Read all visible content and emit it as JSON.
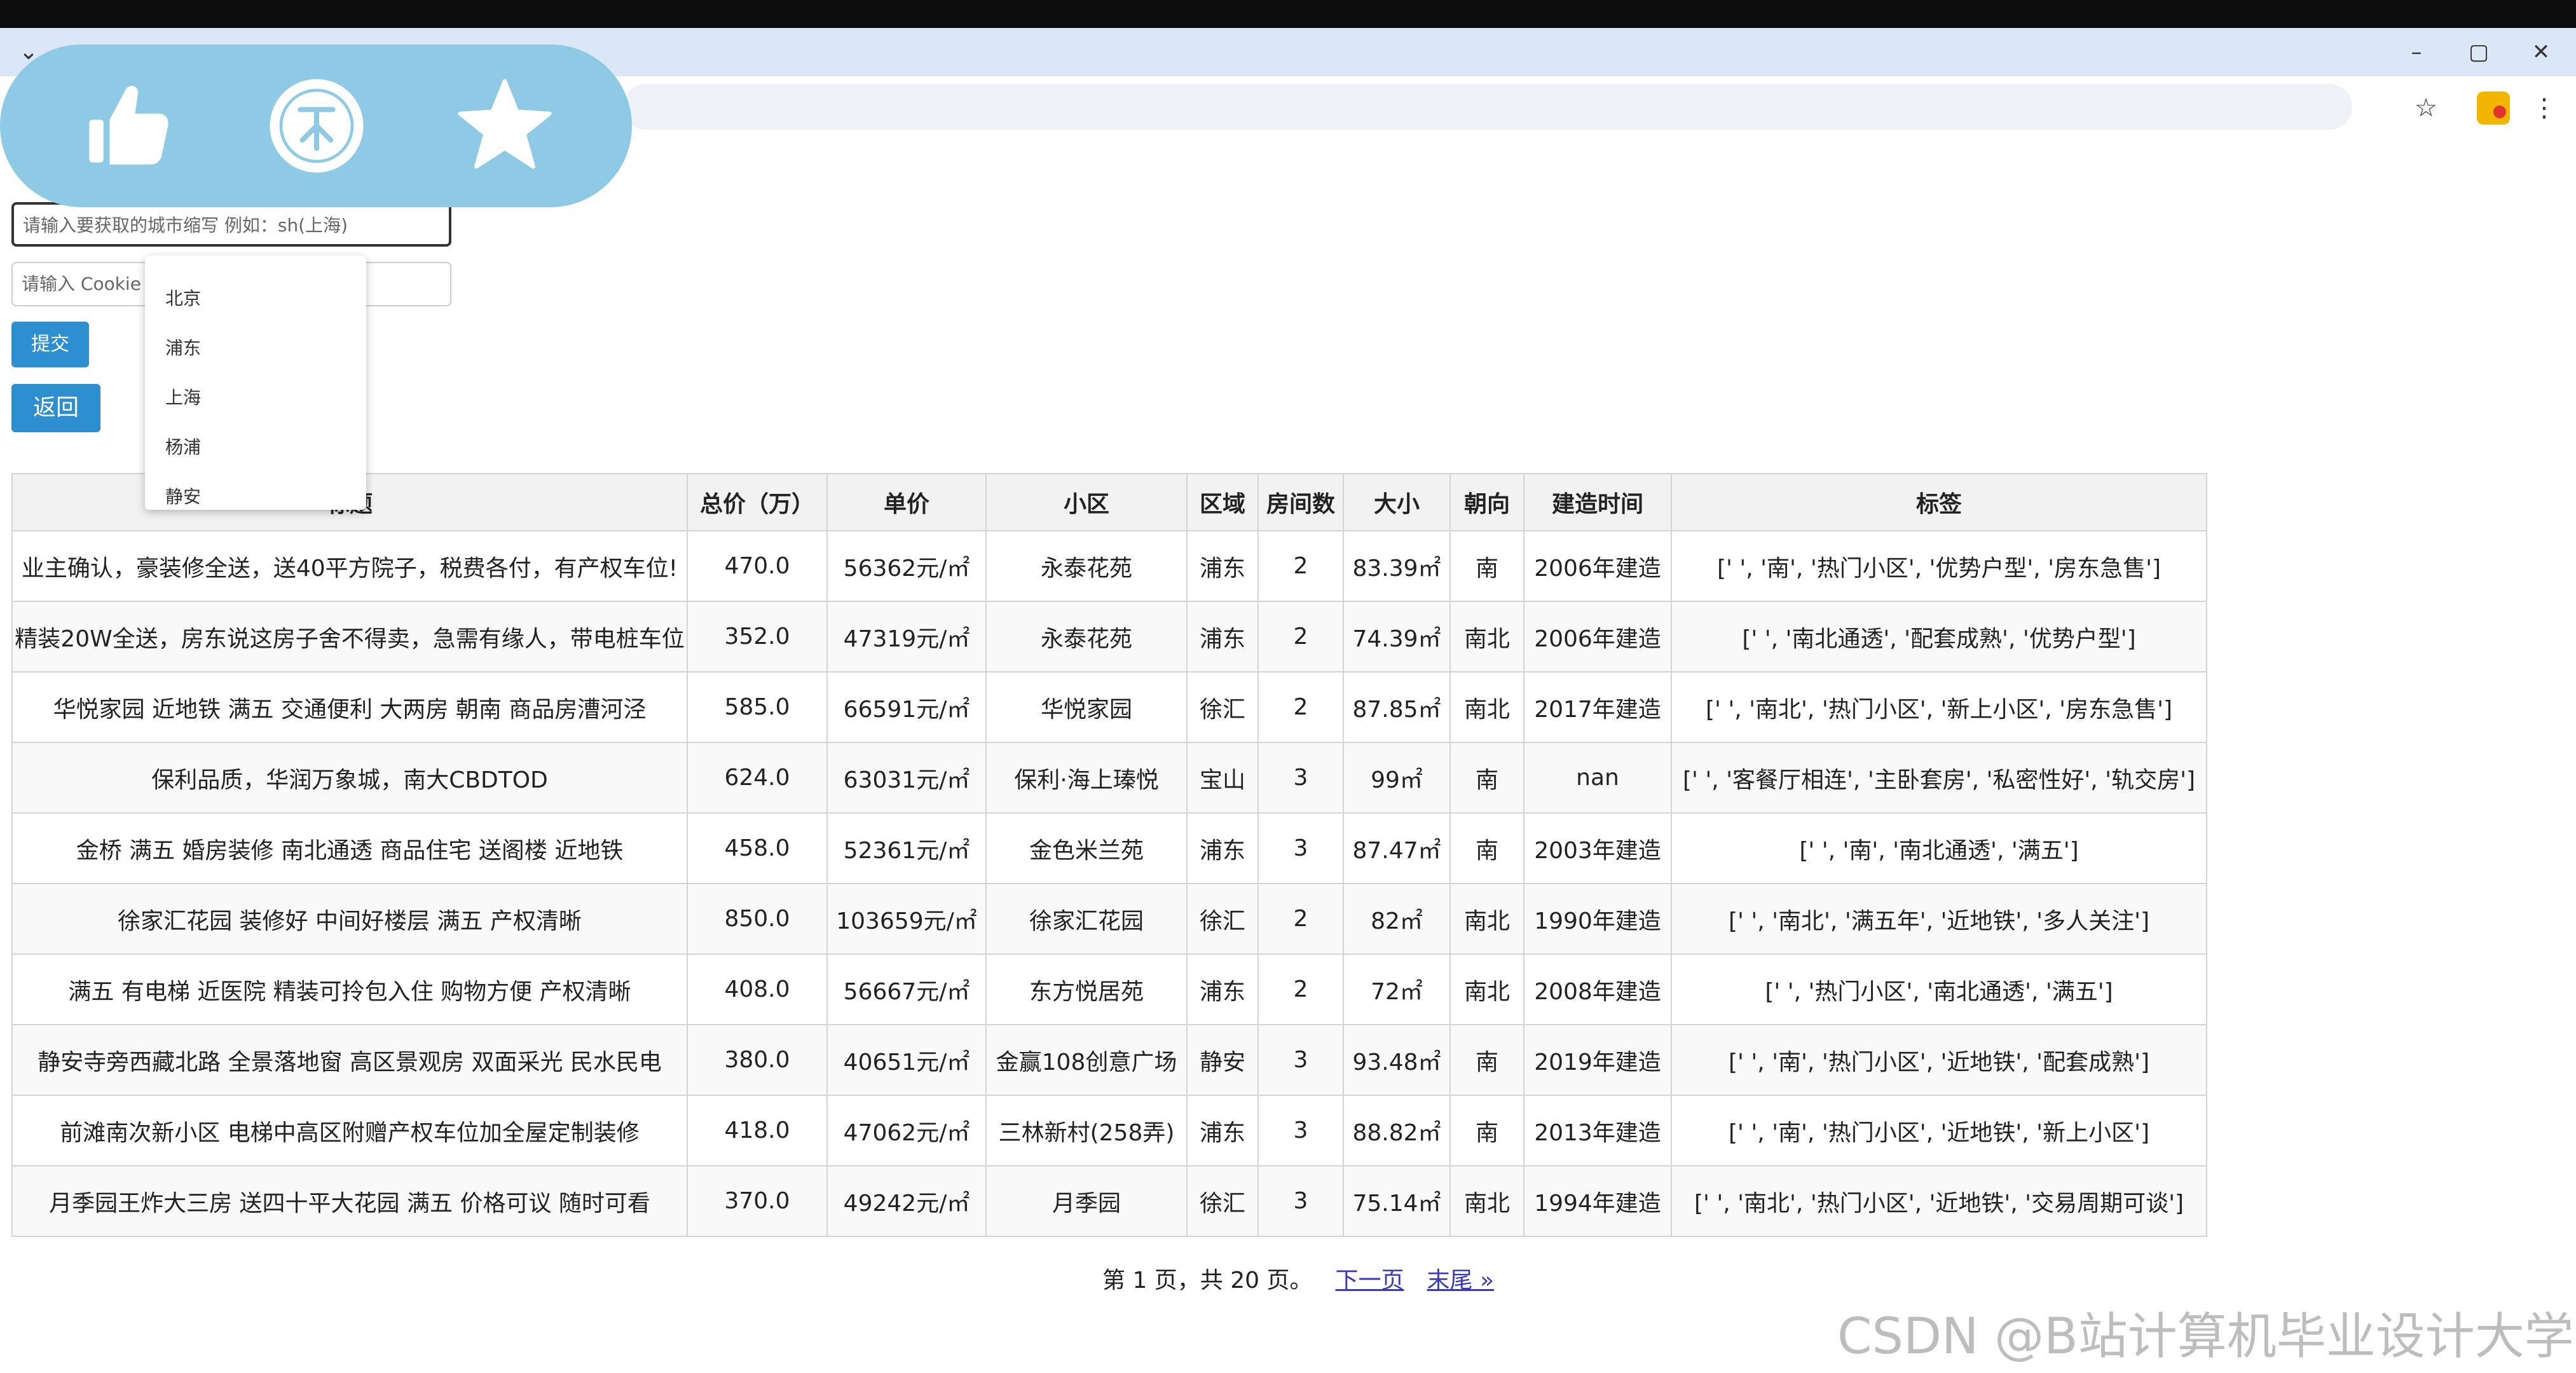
{
  "browser": {
    "tab_menu_icon": "chevron-down-icon",
    "window_controls": [
      "–",
      "▢",
      "✕"
    ]
  },
  "float_bar": {
    "icons": [
      "thumbs-up-icon",
      "coin-icon",
      "star-icon"
    ],
    "color": "#8ec9e6"
  },
  "form": {
    "city_placeholder": "请输入要获取的城市缩写 例如：sh(上海)",
    "cookie_placeholder": "请输入 Cookie",
    "submit_label": "提交",
    "back_label": "返回",
    "dropdown_options": [
      "北京",
      "浦东",
      "上海",
      "杨浦",
      "静安"
    ]
  },
  "table": {
    "headers": [
      "标题",
      "总价（万）",
      "单价",
      "小区",
      "区域",
      "房间数",
      "大小",
      "朝向",
      "建造时间",
      "标签"
    ],
    "rows": [
      [
        "业主确认，豪装修全送，送40平方院子，税费各付，有产权车位!",
        "470.0",
        "56362元/㎡",
        "永泰花苑",
        "浦东",
        "2",
        "83.39㎡",
        "南",
        "2006年建造",
        "[' ', '南', '热门小区', '优势户型', '房东急售']"
      ],
      [
        "精装20W全送，房东说这房子舍不得卖，急需有缘人，带电桩车位",
        "352.0",
        "47319元/㎡",
        "永泰花苑",
        "浦东",
        "2",
        "74.39㎡",
        "南北",
        "2006年建造",
        "[' ', '南北通透', '配套成熟', '优势户型']"
      ],
      [
        "华悦家园 近地铁 满五 交通便利 大两房 朝南 商品房漕河泾",
        "585.0",
        "66591元/㎡",
        "华悦家园",
        "徐汇",
        "2",
        "87.85㎡",
        "南北",
        "2017年建造",
        "[' ', '南北', '热门小区', '新上小区', '房东急售']"
      ],
      [
        "保利品质，华润万象城，南大CBDTOD",
        "624.0",
        "63031元/㎡",
        "保利·海上瑧悦",
        "宝山",
        "3",
        "99㎡",
        "南",
        "nan",
        "[' ', '客餐厅相连', '主卧套房', '私密性好', '轨交房']"
      ],
      [
        "金桥 满五 婚房装修 南北通透 商品住宅 送阁楼 近地铁",
        "458.0",
        "52361元/㎡",
        "金色米兰苑",
        "浦东",
        "3",
        "87.47㎡",
        "南",
        "2003年建造",
        "[' ', '南', '南北通透', '满五']"
      ],
      [
        "徐家汇花园 装修好 中间好楼层 满五 产权清晰",
        "850.0",
        "103659元/㎡",
        "徐家汇花园",
        "徐汇",
        "2",
        "82㎡",
        "南北",
        "1990年建造",
        "[' ', '南北', '满五年', '近地铁', '多人关注']"
      ],
      [
        "满五 有电梯 近医院 精装可拎包入住 购物方便 产权清晰",
        "408.0",
        "56667元/㎡",
        "东方悦居苑",
        "浦东",
        "2",
        "72㎡",
        "南北",
        "2008年建造",
        "[' ', '热门小区', '南北通透', '满五']"
      ],
      [
        "静安寺旁西藏北路 全景落地窗 高区景观房 双面采光 民水民电",
        "380.0",
        "40651元/㎡",
        "金赢108创意广场",
        "静安",
        "3",
        "93.48㎡",
        "南",
        "2019年建造",
        "[' ', '南', '热门小区', '近地铁', '配套成熟']"
      ],
      [
        "前滩南次新小区 电梯中高区附赠产权车位加全屋定制装修",
        "418.0",
        "47062元/㎡",
        "三林新村(258弄)",
        "浦东",
        "3",
        "88.82㎡",
        "南",
        "2013年建造",
        "[' ', '南', '热门小区', '近地铁', '新上小区']"
      ],
      [
        "月季园王炸大三房 送四十平大花园 满五 价格可议 随时可看",
        "370.0",
        "49242元/㎡",
        "月季园",
        "徐汇",
        "3",
        "75.14㎡",
        "南北",
        "1994年建造",
        "[' ', '南北', '热门小区', '近地铁', '交易周期可谈']"
      ]
    ]
  },
  "pagination": {
    "info": "第 1 页，共 20 页。",
    "next_label": "下一页",
    "last_label": "末尾 »"
  },
  "watermark": "CSDN @B站计算机毕业设计大学"
}
